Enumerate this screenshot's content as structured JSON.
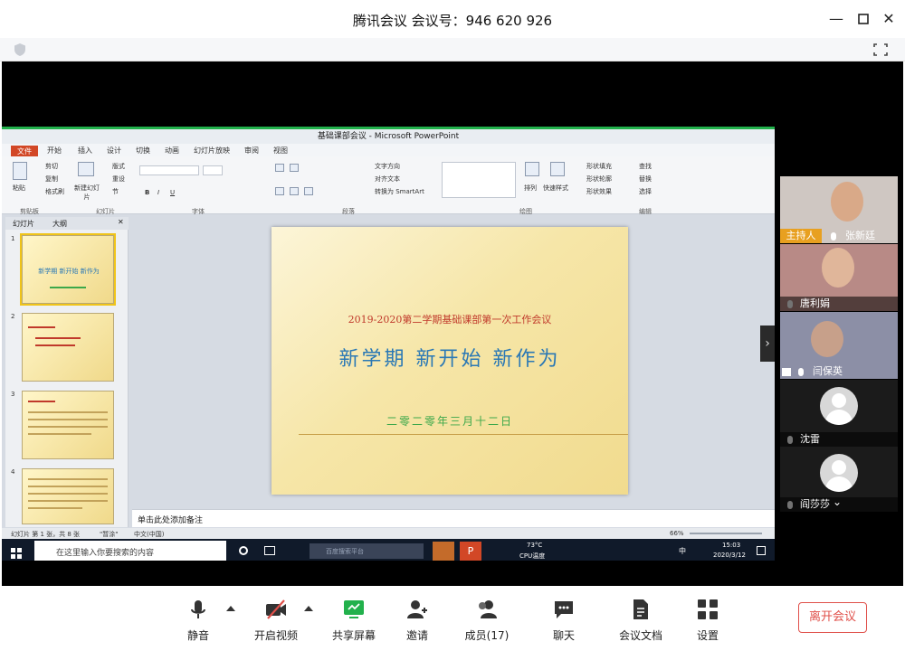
{
  "window": {
    "title": "腾讯会议 会议号：946 620 926"
  },
  "ppt": {
    "title": "基础课部会议 - Microsoft PowerPoint",
    "file_tab": "文件",
    "menu": [
      "开始",
      "插入",
      "设计",
      "切换",
      "动画",
      "幻灯片放映",
      "审阅",
      "视图"
    ],
    "ribbon_groups": [
      "剪贴板",
      "幻灯片",
      "字体",
      "段落",
      "绘图",
      "编辑"
    ],
    "ribbon_labels": {
      "paste": "粘贴",
      "cut": "剪切",
      "copy": "复制",
      "format_painter": "格式刷",
      "new_slide": "新建幻灯片",
      "layout": "版式",
      "reset": "重设",
      "section": "节",
      "text_direction": "文字方向",
      "align_text": "对齐文本",
      "smartart": "转换为 SmartArt",
      "arrange": "排列",
      "quick_styles": "快速样式",
      "shape_fill": "形状填充",
      "shape_outline": "形状轮廓",
      "shape_effects": "形状效果",
      "find": "查找",
      "replace": "替换",
      "select": "选择"
    },
    "thumb_tabs": [
      "幻灯片",
      "大纲"
    ],
    "thumbs": [
      {
        "num": "1",
        "title": "新学期 新开始 新作为"
      },
      {
        "num": "2",
        "title": ""
      },
      {
        "num": "3",
        "title": ""
      },
      {
        "num": "4",
        "title": ""
      }
    ],
    "slide": {
      "subtitle": "2019-2020第二学期基础课部第一次工作会议",
      "main": "新学期  新开始  新作为",
      "date": "二零二零年三月十二日"
    },
    "notes_placeholder": "单击此处添加备注",
    "status": {
      "slide_info": "幻灯片 第 1 张，共 8 张",
      "theme": "\"暂涂\"",
      "language": "中文(中国)",
      "zoom": "66%"
    }
  },
  "taskbar": {
    "search_placeholder": "在这里输入你要搜索的内容",
    "browser_search": "百度搜索平台",
    "temp": "73°C",
    "cpu": "CPU温度",
    "ime": "中",
    "time": "15:03",
    "date": "2020/3/12"
  },
  "participants": [
    {
      "name": "张新廷",
      "badge": "主持人"
    },
    {
      "name": "唐利娟"
    },
    {
      "name": "闫保英"
    },
    {
      "name": "沈雷"
    },
    {
      "name": "阎莎莎"
    }
  ],
  "bottom": {
    "mute": "静音",
    "video": "开启视频",
    "share": "共享屏幕",
    "invite": "邀请",
    "members": "成员(17)",
    "chat": "聊天",
    "docs": "会议文档",
    "settings": "设置",
    "leave": "离开会议"
  },
  "colors": {
    "accent_green": "#22b14c",
    "leave_red": "#e0504a",
    "host_orange": "#e8a020"
  }
}
